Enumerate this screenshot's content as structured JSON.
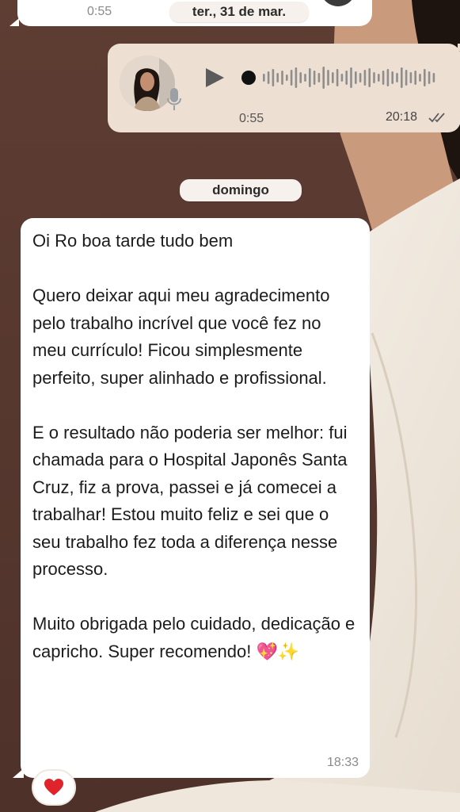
{
  "top_voice": {
    "duration": "0:55"
  },
  "date_chips": {
    "first": "ter., 31 de mar.",
    "second": "domingo"
  },
  "voice_message": {
    "duration": "0:55",
    "time": "20:18",
    "status": "read",
    "accent": "#eedfd3"
  },
  "text_message": {
    "paragraphs": [
      "Oi Ro boa tarde tudo bem",
      "Quero deixar aqui meu agradecimento pelo trabalho incrível que você fez no meu currículo! Ficou simplesmente perfeito, super alinhado e profissional.",
      "E o resultado não poderia ser melhor: fui chamada para o Hospital Japonês Santa Cruz, fiz a prova, passei e já comecei a trabalhar! Estou muito feliz e sei que o seu trabalho fez toda a diferença nesse processo.",
      "Muito obrigada pelo cuidado, dedicação e capricho. Super recomendo!"
    ],
    "trailing_emojis": "💖✨",
    "time": "18:33"
  },
  "reaction": {
    "emoji": "❤️"
  },
  "colors": {
    "wall": "#5a3a30",
    "incoming_bubble": "#ffffff",
    "outgoing_bubble": "#eedfd3",
    "chip": "#f6f1ec"
  }
}
